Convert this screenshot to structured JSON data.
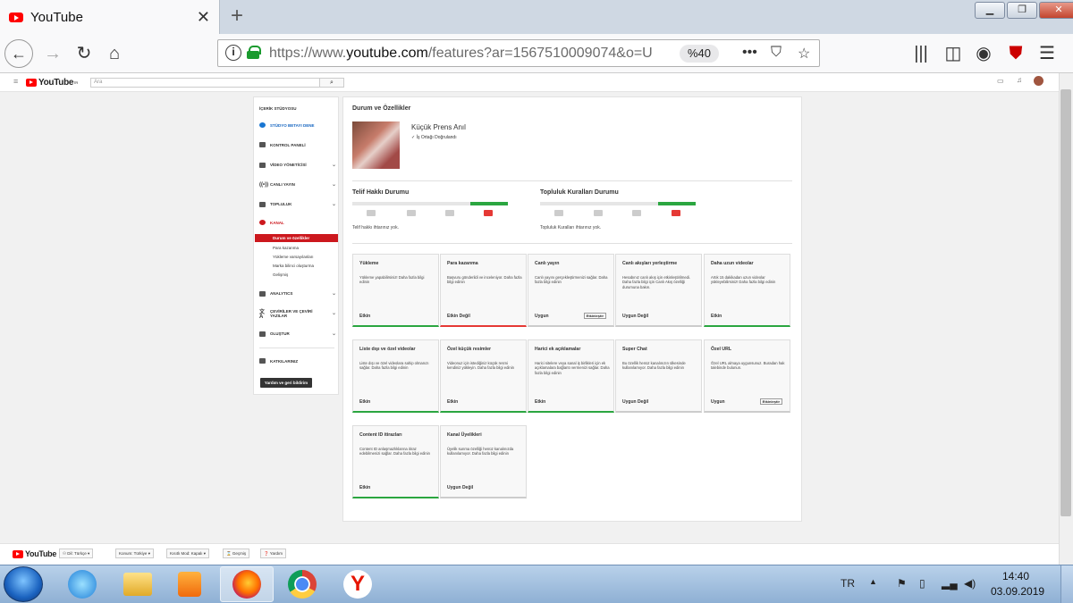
{
  "browser": {
    "tab_title": "YouTube",
    "url_prefix": "https://www.",
    "url_domain": "youtube.com",
    "url_path": "/features?ar=1567510009074&o=U",
    "zoom": "%40"
  },
  "yt_header": {
    "logo": "YouTube",
    "logo_sup": "TR",
    "search_placeholder": "Ara"
  },
  "sidebar": {
    "title": "İÇERİK STÜDYOSU",
    "items": [
      {
        "label": "STÜDYO BETAYI DENE"
      },
      {
        "label": "KONTROL PANELİ"
      },
      {
        "label": "VİDEO YÖNETİCİSİ"
      },
      {
        "label": "CANLI YAYIN"
      },
      {
        "label": "TOPLULUK"
      },
      {
        "label": "KANAL"
      }
    ],
    "subitems": [
      "Durum ve özellikler",
      "Para kazanma",
      "Yükleme varsayılanları",
      "Marka bilinci oluşturma",
      "Gelişmiş"
    ],
    "items2": [
      {
        "label": "ANALYTICS"
      },
      {
        "label": "ÇEVİRİLER VE ÇEVİRİ YAZILAR"
      },
      {
        "label": "OLUŞTUR"
      },
      {
        "label": "KATKILARINIZ"
      }
    ],
    "feedback": "Yardım ve geri bildirim"
  },
  "main": {
    "title": "Durum ve Özellikler",
    "channel_name": "Küçük Prens Anıl",
    "verified": "✓ İş Ortağı Doğrulandı",
    "copyright_title": "Telif Hakkı Durumu",
    "copyright_text": "Telif hakkı ihtarınız yok.",
    "community_title": "Topluluk Kuralları Durumu",
    "community_text": "Topluluk Kuralları ihtarınız yok.",
    "cards": [
      {
        "title": "Yükleme",
        "desc": "Yükleme yapabilirsiniz! Daha fazla bilgi edinin",
        "status": "Etkin",
        "state": "ok"
      },
      {
        "title": "Para kazanma",
        "desc": "Başvuru gönderildi ve inceleniyor. Daha fazla bilgi edinin",
        "status": "Etkin Değil",
        "state": "bad"
      },
      {
        "title": "Canlı yayın",
        "desc": "Canlı yayını gerçekleştirmenizi sağlar. Daha fazla bilgi edinin",
        "status": "Uygun",
        "state": "none",
        "button": "Etkinleştir"
      },
      {
        "title": "Canlı akışları yerleştirme",
        "desc": "Hesabınız canlı akış için etkinleştirilmedi. Daha fazla bilgi için Canlı Akış özelliği durumuna bakın.",
        "status": "Uygun Değil",
        "state": "none"
      },
      {
        "title": "Daha uzun videolar",
        "desc": "Artık 15 dakikadan uzun videolar yükleyebilirsiniz! Daha fazla bilgi edinin",
        "status": "Etkin",
        "state": "ok"
      },
      {
        "title": "Liste dışı ve özel videolar",
        "desc": "Liste dışı ve özel videolara sahip olmanızı sağlar. Daha fazla bilgi edinin",
        "status": "Etkin",
        "state": "ok"
      },
      {
        "title": "Özel küçük resimler",
        "desc": "Videonuz için istediğiniz küçük resmi kendiniz yükleyin. Daha fazla bilgi edinin",
        "status": "Etkin",
        "state": "ok"
      },
      {
        "title": "Harici ek açıklamalar",
        "desc": "Harici sitelere veya sanal iş birlikleri için ek açıklamalara bağlantı vermenizi sağlar. Daha fazla bilgi edinin",
        "status": "Etkin",
        "state": "ok"
      },
      {
        "title": "Super Chat",
        "desc": "Bu özellik henüz kanalınızın ülkesinde kullanılamıyor. Daha fazla bilgi edinin",
        "status": "Uygun Değil",
        "state": "none"
      },
      {
        "title": "Özel URL",
        "desc": "Özel URL almaya uygunsunuz. Buradan hak talebinde bulunun.",
        "status": "Uygun",
        "state": "none",
        "button": "Etkinleştir"
      },
      {
        "title": "Content ID itirazları",
        "desc": "Content ID anlaşmazlıklarına itiraz edebilmenizi sağlar. Daha fazla bilgi edinin",
        "status": "Etkin",
        "state": "ok"
      },
      {
        "title": "Kanal Üyelikleri",
        "desc": "Üyelik sunma özelliği henüz kanalınızda kullanılamıyor. Daha fazla bilgi edinin",
        "status": "Uygun Değil",
        "state": "none"
      }
    ]
  },
  "footer": {
    "logo": "YouTube",
    "buttons": [
      "Dil: Türkçe",
      "Konum: Türkiye",
      "Kısıtlı Mod: Kapalı",
      "Geçmiş",
      "Yardım"
    ]
  },
  "taskbar": {
    "lang": "TR",
    "time": "14:40",
    "date": "03.09.2019"
  }
}
